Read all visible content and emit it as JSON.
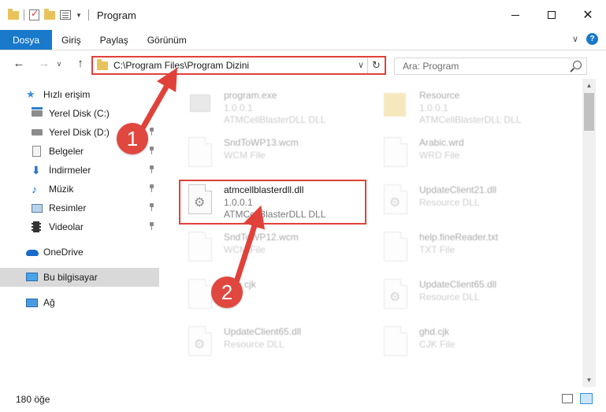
{
  "window": {
    "title": "Program",
    "minimize": "—",
    "close": "✕"
  },
  "ribbon": {
    "tabs": [
      "Dosya",
      "Giriş",
      "Paylaş",
      "Görünüm"
    ],
    "help": "?",
    "expand": "∨"
  },
  "navigation": {
    "back": "←",
    "forward": "→",
    "history": "∨",
    "up": "↑"
  },
  "address": {
    "path": "C:\\Program Files\\Program Dizini",
    "dropdown": "∨",
    "refresh": "↻"
  },
  "search": {
    "placeholder": "Ara: Program"
  },
  "sidebar": {
    "items": [
      {
        "label": "Hızlı erişim",
        "icon": "star-icon",
        "pinned": false
      },
      {
        "label": "Yerel Disk (C:)",
        "icon": "drive-c-icon",
        "pinned": true
      },
      {
        "label": "Yerel Disk (D:)",
        "icon": "drive-d-icon",
        "pinned": true
      },
      {
        "label": "Belgeler",
        "icon": "documents-icon",
        "pinned": true
      },
      {
        "label": "İndirmeler",
        "icon": "downloads-icon",
        "pinned": true
      },
      {
        "label": "Müzik",
        "icon": "music-icon",
        "pinned": true
      },
      {
        "label": "Resimler",
        "icon": "pictures-icon",
        "pinned": true
      },
      {
        "label": "Videolar",
        "icon": "videos-icon",
        "pinned": true
      },
      {
        "label": "OneDrive",
        "icon": "onedrive-icon",
        "pinned": false
      },
      {
        "label": "Bu bilgisayar",
        "icon": "this-pc-icon",
        "pinned": false,
        "selected": true
      },
      {
        "label": "Ağ",
        "icon": "network-icon",
        "pinned": false
      }
    ]
  },
  "files": [
    {
      "name": "program.exe",
      "line2": "1.0.0.1",
      "line3": "ATMCellBlasterDLL DLL",
      "icon": "exe-icon",
      "faded": true
    },
    {
      "name": "Resource",
      "line2": "1.0.0.1",
      "line3": "ATMCellBlasterDLL DLL",
      "icon": "folder-icon",
      "faded": true
    },
    {
      "name": "SndToWP13.wcm",
      "line2": "WCM File",
      "line3": "",
      "icon": "file-icon",
      "faded": true
    },
    {
      "name": "Arabic.wrd",
      "line2": "WRD File",
      "line3": "",
      "icon": "file-icon",
      "faded": true
    },
    {
      "name": "atmcellblasterdll.dll",
      "line2": "1.0.0.1",
      "line3": "ATMCellBlasterDLL DLL",
      "icon": "dll-gear-icon",
      "faded": false
    },
    {
      "name": "UpdateClient21.dll",
      "line2": "Resource DLL",
      "line3": "",
      "icon": "dll-gear-icon",
      "faded": true
    },
    {
      "name": "SndToWP12.wcm",
      "line2": "WCM File",
      "line3": "",
      "icon": "file-icon",
      "faded": true
    },
    {
      "name": "help.fineReader.txt",
      "line2": "TXT File",
      "line3": "",
      "icon": "file-icon",
      "faded": true
    },
    {
      "name": "plan.cjk",
      "line2": "",
      "line3": "",
      "icon": "file-icon",
      "faded": true
    },
    {
      "name": "UpdateClient65.dll",
      "line2": "Resource DLL",
      "line3": "",
      "icon": "dll-gear-icon",
      "faded": true
    },
    {
      "name": "UpdateClient65.dll",
      "line2": "Resource DLL",
      "line3": "",
      "icon": "dll-gear-icon",
      "faded": true
    },
    {
      "name": "ghd.cjk",
      "line2": "CJK File",
      "line3": "",
      "icon": "file-icon",
      "faded": true
    }
  ],
  "status": {
    "item_count": "180 öğe"
  },
  "annotations": {
    "step1": "1",
    "step2": "2",
    "accent": "#e0423a"
  },
  "colors": {
    "file_tab": "#1979ca",
    "selected_nav": "#d9d9d9"
  }
}
